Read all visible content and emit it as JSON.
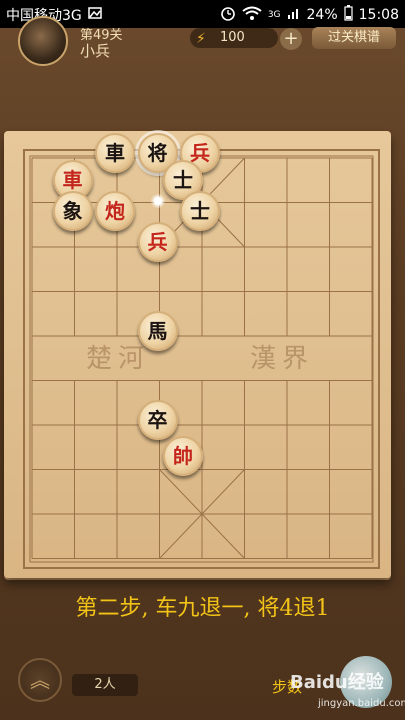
{
  "status_bar": {
    "carrier": "中国移动3G",
    "network": "3G",
    "battery": "24%",
    "time": "15:08"
  },
  "header": {
    "level_text": "第49关",
    "player_name": "小兵",
    "energy": "100",
    "plus_label": "+",
    "manual_button": "过关棋谱"
  },
  "board": {
    "river_left": "楚河",
    "river_right": "漢界",
    "pieces": [
      {
        "char": "車",
        "side": "black",
        "col": 0,
        "row": 0
      },
      {
        "char": "将",
        "side": "black",
        "col": 1,
        "row": 0,
        "selected": true
      },
      {
        "char": "兵",
        "side": "red",
        "col": 2,
        "row": 0
      },
      {
        "char": "車",
        "side": "red",
        "col": -1,
        "row": 0.6
      },
      {
        "char": "士",
        "side": "black",
        "col": 1.6,
        "row": 0.6
      },
      {
        "char": "象",
        "side": "black",
        "col": -1,
        "row": 1.3
      },
      {
        "char": "炮",
        "side": "red",
        "col": 0,
        "row": 1.3
      },
      {
        "char": "士",
        "side": "black",
        "col": 2,
        "row": 1.3
      },
      {
        "char": "兵",
        "side": "red",
        "col": 1,
        "row": 2
      },
      {
        "char": "馬",
        "side": "black",
        "col": 1,
        "row": 4
      },
      {
        "char": "卒",
        "side": "black",
        "col": 1,
        "row": 6
      },
      {
        "char": "帥",
        "side": "red",
        "col": 1.6,
        "row": 6.8
      }
    ]
  },
  "caption": "第二步, 车九退一, 将4退1",
  "footer": {
    "players": "2人",
    "steps_label": "步数",
    "watermark": "Baidu经验",
    "watermark_sub": "jingyan.baidu.com"
  }
}
